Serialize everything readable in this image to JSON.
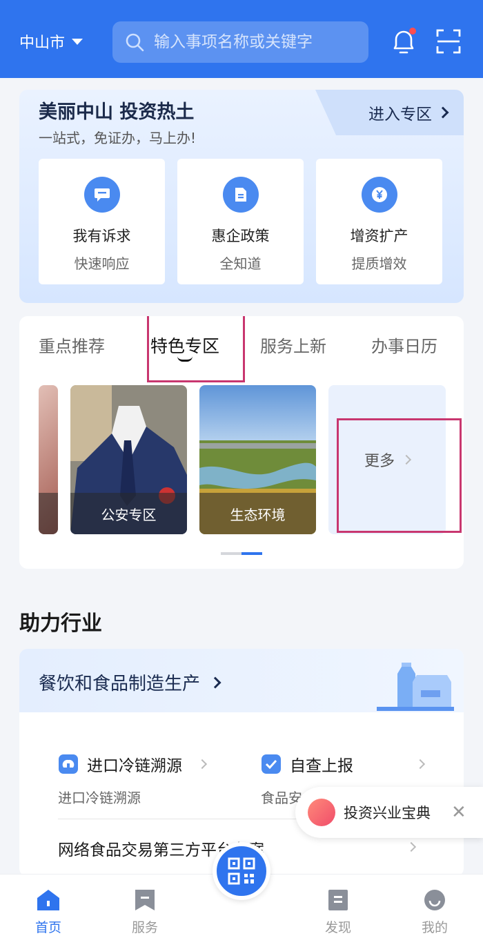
{
  "header": {
    "city": "中山市",
    "search_placeholder": "输入事项名称或关键字"
  },
  "promo": {
    "title": "美丽中山 投资热土",
    "subtitle": "一站式，免证办，马上办!",
    "enter_label": "进入专区",
    "items": [
      {
        "title": "我有诉求",
        "sub": "快速响应"
      },
      {
        "title": "惠企政策",
        "sub": "全知道"
      },
      {
        "title": "增资扩产",
        "sub": "提质增效"
      }
    ]
  },
  "tabs": [
    "重点推荐",
    "特色专区",
    "服务上新",
    "办事日历"
  ],
  "tiles": {
    "items": [
      "公安专区",
      "生态环境"
    ],
    "more_label": "更多"
  },
  "industry": {
    "section_title": "助力行业",
    "category": "餐饮和食品制造生产",
    "services": {
      "s1_title": "进口冷链溯源",
      "s1_sub": "进口冷链溯源",
      "s2_title": "自查上报",
      "s2_sub": "食品安",
      "s3_title": "网络食品交易第三方平台备案"
    }
  },
  "floating": {
    "label": "投资兴业宝典"
  },
  "nav": {
    "home": "首页",
    "service": "服务",
    "discover": "发现",
    "mine": "我的"
  },
  "colors": {
    "brand": "#2f74ee",
    "highlight": "#c8366f"
  }
}
